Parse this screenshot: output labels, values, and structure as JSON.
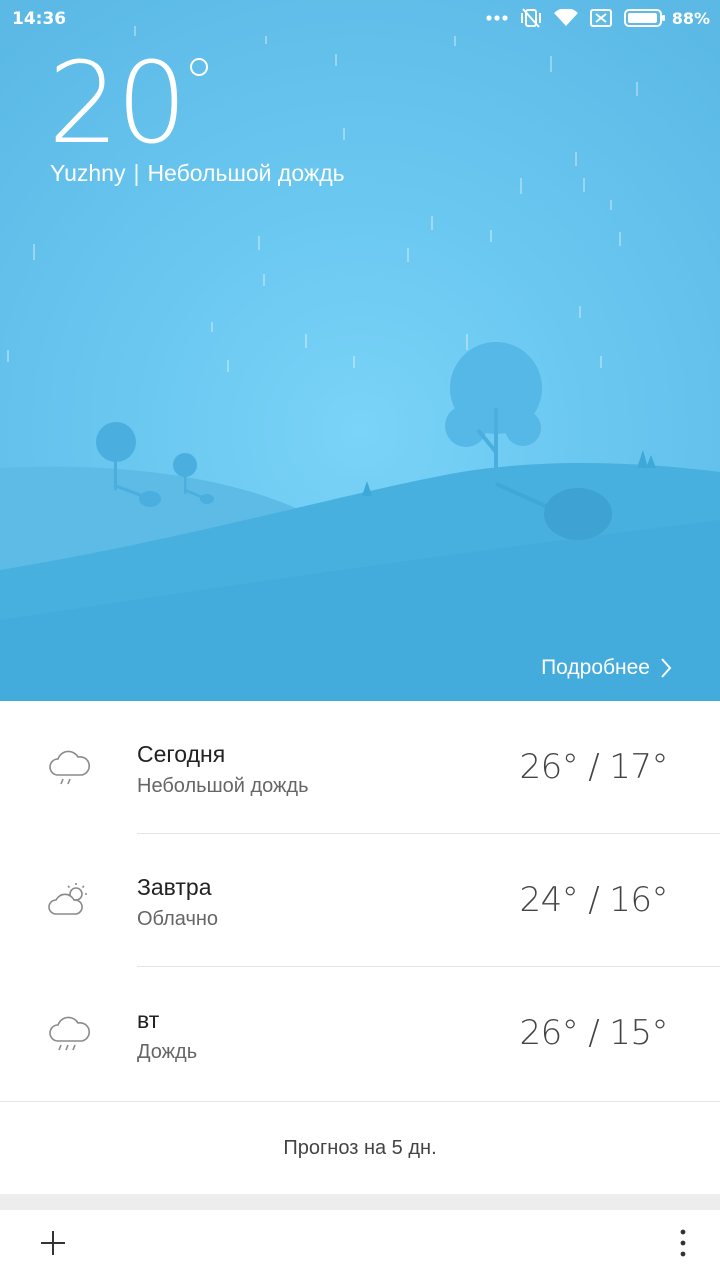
{
  "status_bar": {
    "time": "14:36",
    "battery_percent": "88%",
    "icons": [
      "more-dots-icon",
      "vibrate-off-icon",
      "wifi-icon",
      "no-sim-icon",
      "battery-icon"
    ]
  },
  "current": {
    "temperature": "20",
    "city": "Yuzhny",
    "separator": "|",
    "condition": "Небольшой дождь",
    "details_label": "Подробнее"
  },
  "forecast": [
    {
      "day": "Сегодня",
      "condition": "Небольшой дождь",
      "high": "26°",
      "low": "17°",
      "icon": "light-rain-icon"
    },
    {
      "day": "Завтра",
      "condition": "Облачно",
      "high": "24°",
      "low": "16°",
      "icon": "partly-cloudy-icon"
    },
    {
      "day": "вт",
      "condition": "Дождь",
      "high": "26°",
      "low": "15°",
      "icon": "rain-icon"
    }
  ],
  "forecast_more_label": "Прогноз на 5 дн.",
  "colors": {
    "sky_light": "#7ad3f8",
    "sky_dark": "#5cb9e6",
    "hill_front": "#3fa9d9",
    "hill_back": "#56b7e4",
    "tree": "#4fb3e3",
    "divider": "#e4e4e4"
  }
}
